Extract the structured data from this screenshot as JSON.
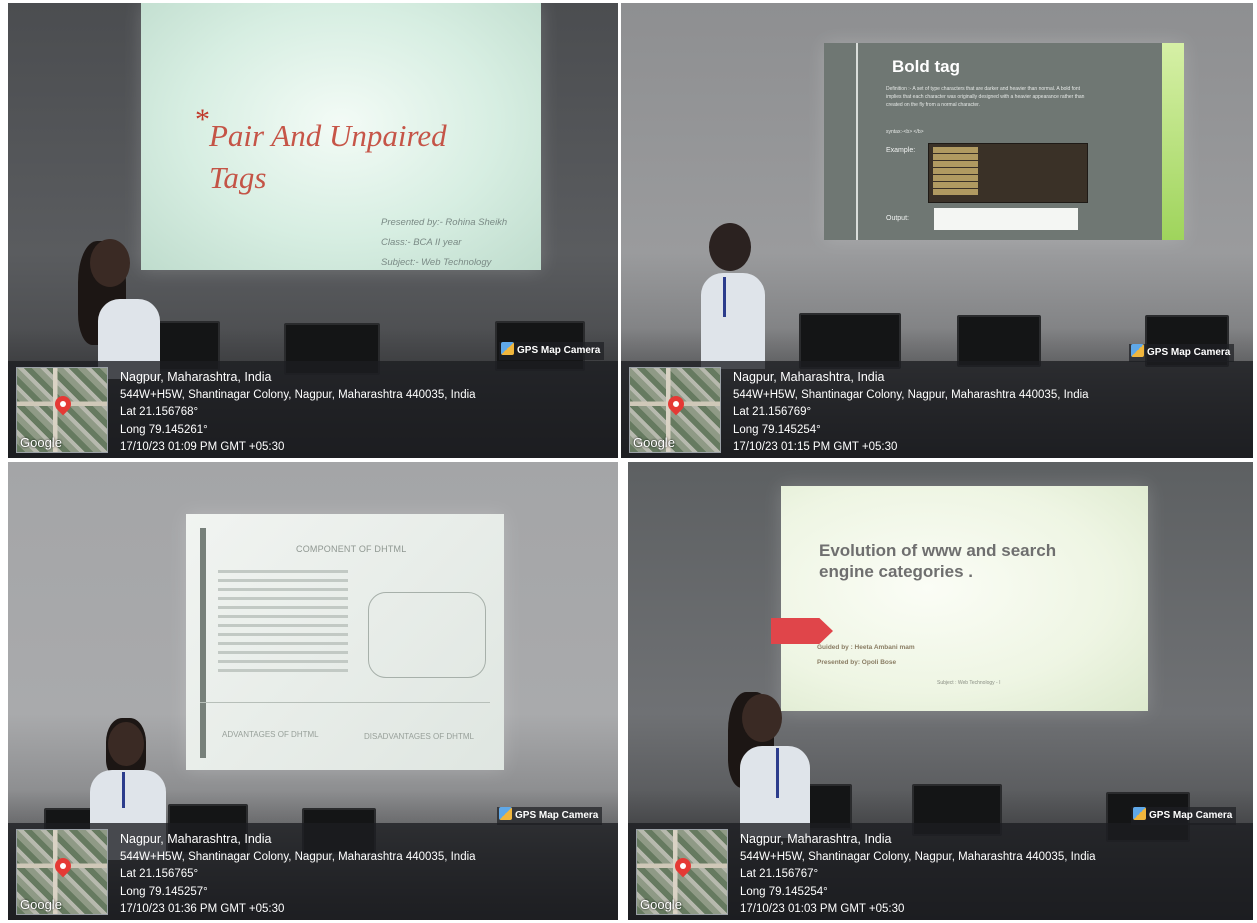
{
  "gps_app_name": "GPS Map Camera",
  "map_logo": "Google",
  "panels": [
    {
      "slide": {
        "star": "*",
        "title": "Pair And Unpaired Tags",
        "presented_by": "Presented by:- Rohina Sheikh",
        "class": "Class:- BCA II year",
        "subject": "Subject:- Web Technology"
      },
      "gps": {
        "city": "Nagpur, Maharashtra, India",
        "address": "544W+H5W, Shantinagar Colony, Nagpur, Maharashtra 440035, India",
        "lat": "Lat 21.156768°",
        "long": "Long 79.145261°",
        "timestamp": "17/10/23 01:09 PM GMT +05:30"
      }
    },
    {
      "slide": {
        "title": "Bold tag",
        "definition": "Definition :- A set of type characters that are darker and heavier than normal. A bold font implies that each character was originally designed with a heavier appearance rather than created on the fly from a normal character.",
        "syntax": "syntax:-<b> </b>",
        "example_label": "Example:",
        "output_label": "Output:"
      },
      "gps": {
        "city": "Nagpur, Maharashtra, India",
        "address": "544W+H5W, Shantinagar Colony, Nagpur, Maharashtra 440035, India",
        "lat": "Lat 21.156769°",
        "long": "Long 79.145254°",
        "timestamp": "17/10/23 01:15 PM GMT +05:30"
      }
    },
    {
      "slide": {
        "title": "COMPONENT OF DHTML",
        "advantages": "ADVANTAGES OF DHTML",
        "disadvantages": "DISADVANTAGES OF DHTML"
      },
      "gps": {
        "city": "Nagpur, Maharashtra, India",
        "address": "544W+H5W, Shantinagar Colony, Nagpur, Maharashtra 440035, India",
        "lat": "Lat 21.156765°",
        "long": "Long 79.145257°",
        "timestamp": "17/10/23 01:36 PM GMT +05:30"
      }
    },
    {
      "slide": {
        "title": "Evolution of www and search engine categories .",
        "guided_by": "Guided by : Heeta Ambani mam",
        "presented_by": "Presented by: Opoli Bose",
        "subject": "Subject : Web Technology - I"
      },
      "gps": {
        "city": "Nagpur, Maharashtra, India",
        "address": "544W+H5W, Shantinagar Colony, Nagpur, Maharashtra 440035, India",
        "lat": "Lat 21.156767°",
        "long": "Long 79.145254°",
        "timestamp": "17/10/23 01:03 PM GMT +05:30"
      }
    }
  ]
}
